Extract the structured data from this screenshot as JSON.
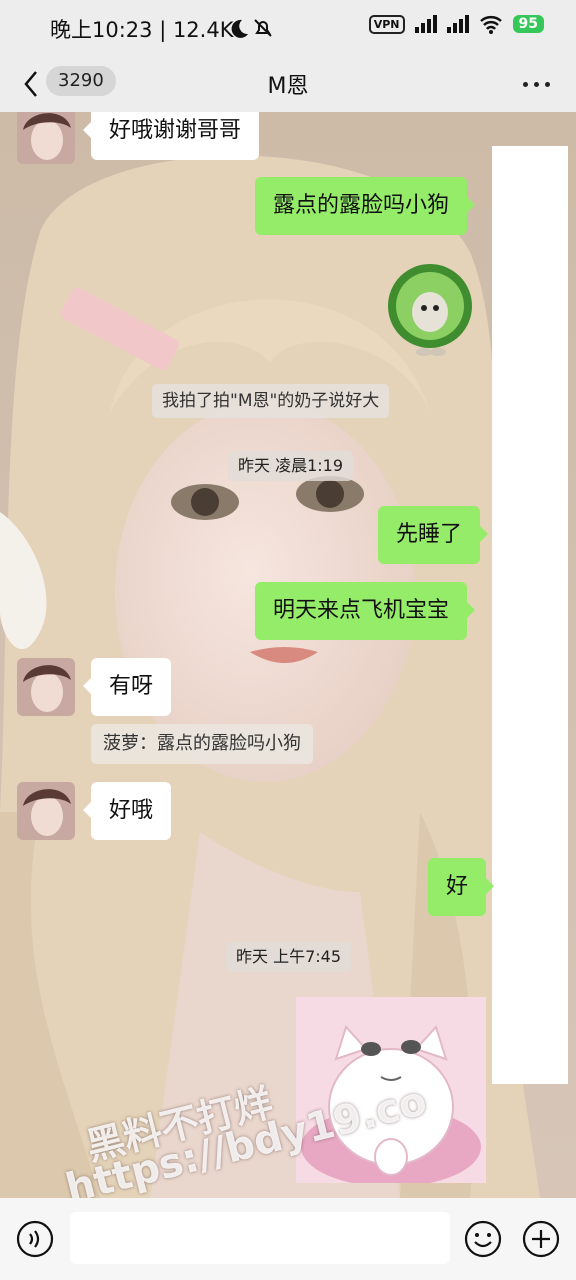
{
  "status_bar": {
    "time": "晚上10:23 | 12.4K",
    "vpn": "VPN",
    "battery": "95"
  },
  "nav": {
    "unread_count": "3290",
    "title": "M恩"
  },
  "messages": {
    "m1": "好哦谢谢哥哥",
    "m2": "露点的露脸吗小狗",
    "sys1": "我拍了拍\"M恩\"的奶子说好大",
    "time1": "昨天 凌晨1:19",
    "m3": "先睡了",
    "m4": "明天来点飞机宝宝",
    "m5": "有呀",
    "quote1": "菠萝：露点的露脸吗小狗",
    "m6": "好哦",
    "m7": "好",
    "time2": "昨天 上午7:45"
  },
  "watermark": {
    "line1": "黑料不打烊",
    "line2": "https://bdy19.co"
  },
  "icons": [
    "back-icon",
    "more-icon",
    "voice-icon",
    "emoji-icon",
    "plus-icon"
  ],
  "colors": {
    "outgoing_bubble": "#95ec69",
    "incoming_bubble": "#ffffff",
    "bar_bg": "#ededed"
  }
}
